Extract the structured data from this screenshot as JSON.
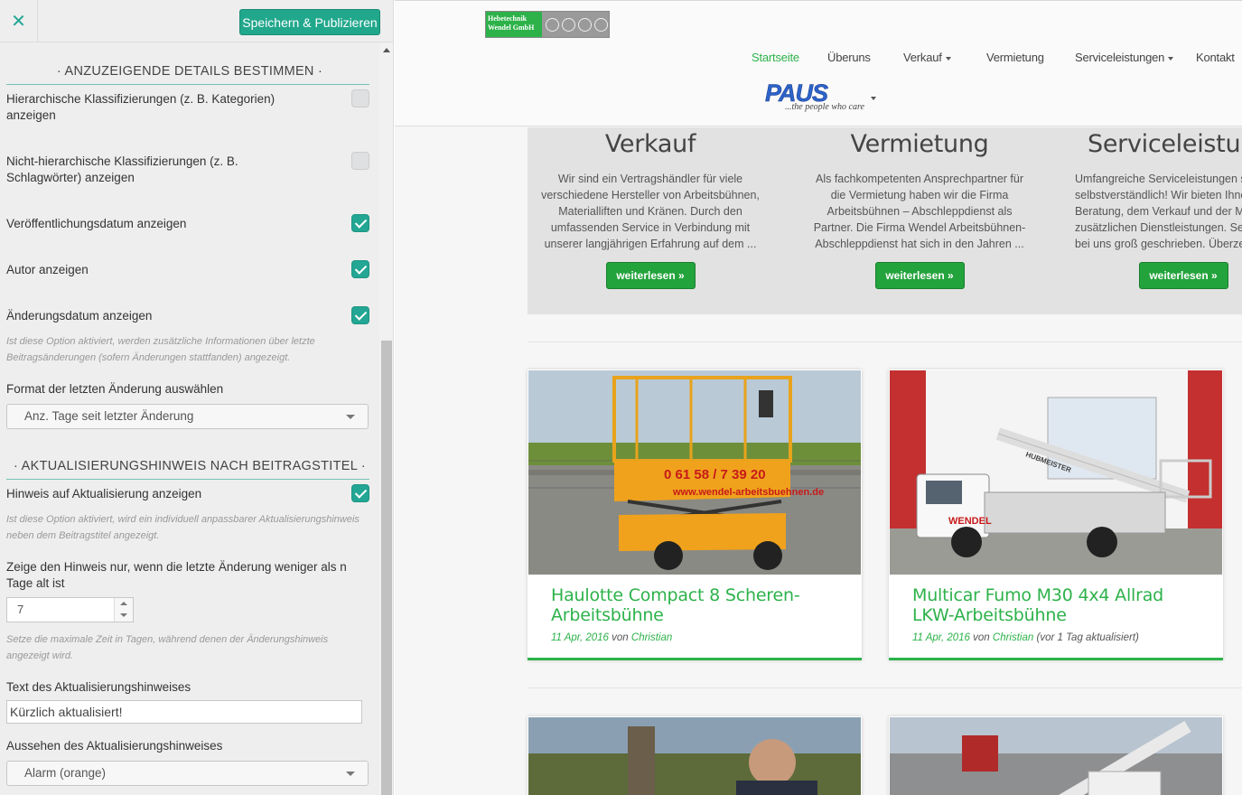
{
  "customizer": {
    "close_icon": "close-icon",
    "save_label": "Speichern & Publizieren",
    "section1_title": "· ANZUZEIGENDE DETAILS BESTIMMEN ·",
    "opt_hier_label": "Hierarchische Klassifizierungen (z. B. Kategorien) anzeigen",
    "opt_hier_checked": false,
    "opt_nonhier_label": "Nicht-hierarchische Klassifizierungen (z. B. Schlagwörter) anzeigen",
    "opt_nonhier_checked": false,
    "opt_pubdate_label": "Veröffentlichungsdatum anzeigen",
    "opt_pubdate_checked": true,
    "opt_author_label": "Autor anzeigen",
    "opt_author_checked": true,
    "opt_moddate_label": "Änderungsdatum anzeigen",
    "opt_moddate_checked": true,
    "moddate_desc": "Ist diese Option aktiviert, werden zusätzliche Informationen über letzte Beitragsänderungen (sofern Änderungen stattfanden) angezeigt.",
    "format_label": "Format der letzten Änderung auswählen",
    "format_value": "Anz. Tage seit letzter Änderung",
    "section2_title": "· AKTUALISIERUNGSHINWEIS NACH BEITRAGSTITEL ·",
    "opt_notice_label": "Hinweis auf Aktualisierung anzeigen",
    "opt_notice_checked": true,
    "notice_desc": "Ist diese Option aktiviert, wird ein individuell anpassbarer Aktualisierungshinweis neben dem Beitragstitel angezeigt.",
    "days_label": "Zeige den Hinweis nur, wenn die letzte Änderung weniger als n Tage alt ist",
    "days_value": "7",
    "days_desc": "Setze die maximale Zeit in Tagen, während denen der Änderungshinweis angezeigt wird.",
    "text_label": "Text des Aktualisierungshinweises",
    "text_value": "Kürzlich aktualisiert!",
    "style_label": "Aussehen des Aktualisierungshinweises",
    "style_value": "Alarm (orange)",
    "accent_color": "#23a694"
  },
  "site": {
    "logo_text_line1": "Hebetechnik",
    "logo_text_line2": "Wendel GmbH",
    "nav": [
      "Startseite",
      "Überuns",
      "Verkauf",
      "Vermietung",
      "Serviceleistungen",
      "Kontakt"
    ],
    "partner_logo_word": "PAUS",
    "partner_logo_tagline": "...the people who care",
    "services": [
      {
        "title": "Verkauf",
        "text": "Wir sind ein Vertragshändler für viele verschiedene Hersteller von Arbeitsbühnen, Materialliften und Kränen. Durch den umfassenden Service in Verbindung mit unserer langjährigen Erfahrung auf dem ...",
        "button": "weiterlesen »"
      },
      {
        "title": "Vermietung",
        "text": "Als fachkompetenten Ansprechpartner für die Vermietung haben wir die Firma Arbeitsbühnen – Abschleppdienst als Partner. Die Firma Wendel Arbeitsbühnen-Abschleppdienst hat sich in den Jahren ...",
        "button": "weiterlesen »"
      },
      {
        "title": "Serviceleistungen",
        "text": "Umfangreiche Serviceleistungen sind für uns selbstverständlich! Wir bieten Ihnen neben der Beratung, dem Verkauf und der Menge zusätzlichen Dienstleistungen. Service wird bei uns groß geschrieben. Überzeugen ...",
        "button": "weiterlesen »"
      }
    ],
    "posts": [
      {
        "title": "Haulotte Compact 8 Scheren-Arbeitsbühne",
        "date": "11 Apr, 2016",
        "by": "von",
        "author": "Christian",
        "updated": ""
      },
      {
        "title": "Multicar Fumo M30 4x4 Allrad LKW-Arbeitsbühne",
        "date": "11 Apr, 2016",
        "by": "von",
        "author": "Christian",
        "updated": "(vor 1 Tag aktualisiert)"
      }
    ],
    "brand_green": "#2db24a",
    "phone_on_lift": "0 61 58 / 7 39 20",
    "url_on_lift": "www.wendel-arbeitsbuehnen.de",
    "truck_brand": "WENDEL",
    "truck_side": "HUBMEISTER"
  }
}
